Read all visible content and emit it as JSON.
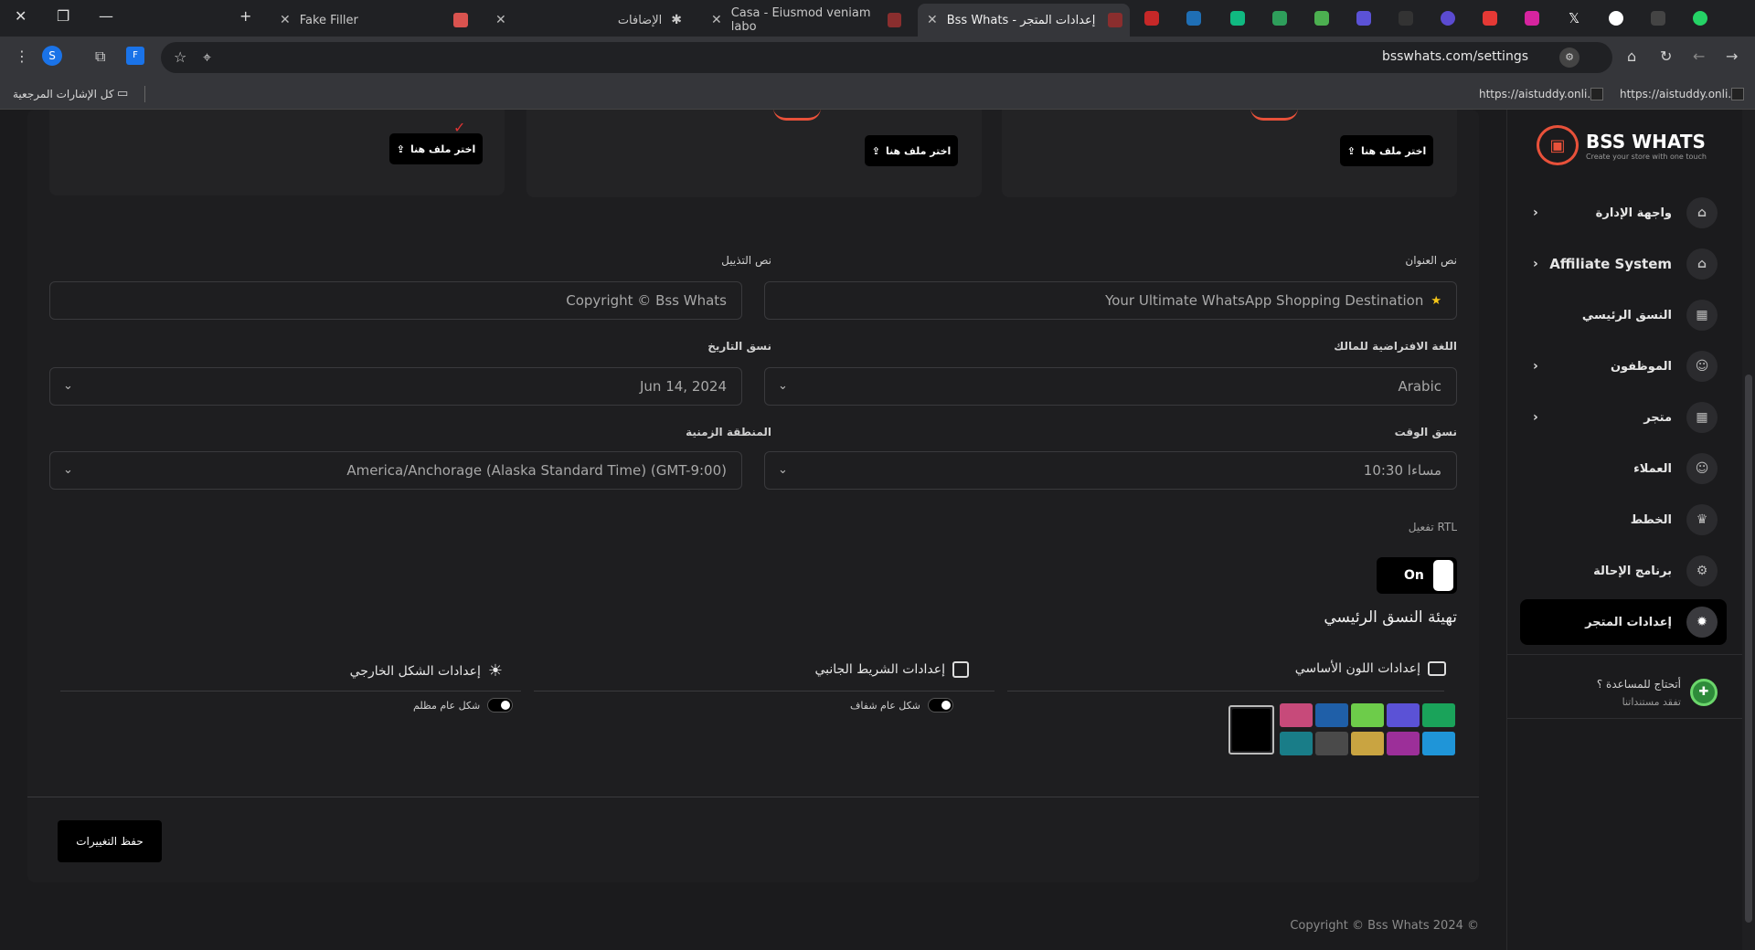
{
  "browser": {
    "tabs": [
      {
        "title": "Fake Filler"
      },
      {
        "title": "الإضافات"
      },
      {
        "title": "Casa - Eiusmod veniam labo"
      },
      {
        "title": "Bss Whats - إعدادات المتجر"
      }
    ],
    "url": "bsswhats.com/settings",
    "bookmarks": {
      "all_bookmarks": "كل الإشارات المرجعية",
      "bm1": "https://aistuddy.onli...",
      "bm2": "https://aistuddy.onli..."
    },
    "profile_initial": "S"
  },
  "logo": {
    "title": "BSS WHATS",
    "tagline": "Create your store with one touch"
  },
  "sidebar": {
    "items": [
      {
        "label": "واجهة الإدارة"
      },
      {
        "label": "Affiliate System"
      },
      {
        "label": "النسق الرئيسي"
      },
      {
        "label": "الموظفون"
      },
      {
        "label": "متجر"
      },
      {
        "label": "العملاء"
      },
      {
        "label": "الخطط"
      },
      {
        "label": "برنامج الإحالة"
      },
      {
        "label": "إعدادات المتجر"
      }
    ],
    "help": {
      "title": "أتحتاج للمساعدة ؟",
      "subtitle": "تفقد مستنداتنا"
    }
  },
  "uploads": {
    "button_label": "اختر ملف هنا"
  },
  "form": {
    "header_text_label": "نص العنوان",
    "header_text_value": "Your Ultimate WhatsApp Shopping Destination",
    "footer_text_label": "نص التذييل",
    "footer_text_value": "Copyright © Bss Whats",
    "default_language_label": "اللغة الافتراضية للمالك",
    "default_language_value": "Arabic",
    "date_format_label": "نسق التاريخ",
    "date_format_value": "Jun 14, 2024",
    "time_format_label": "نسق الوقت",
    "time_format_value": "10:30 مساءا",
    "timezone_label": "المنطقة الزمنية",
    "timezone_value": "America/Anchorage (Alaska Standard Time) (GMT-9:00)",
    "rtl_label": "تفعيل RTL",
    "rtl_state": "On"
  },
  "theme": {
    "title": "تهيئة النسق الرئيسي",
    "primary_color_title": "إعدادات اللون الأساسي",
    "sidebar_title": "إعدادات الشريط الجانبي",
    "sidebar_toggle_label": "شكل عام شفاف",
    "layout_title": "إعدادات الشكل الخارجي",
    "layout_toggle_label": "شكل عام مظلم",
    "colors": [
      "#1aa35a",
      "#5b52d6",
      "#6dcc4a",
      "#1f5fa8",
      "#c74a7a",
      "#1f95d8",
      "#9c2f99",
      "#c9a441",
      "#4a4a4a",
      "#197d88"
    ],
    "selected_color": "#000000"
  },
  "save_button": "حفظ التغييرات",
  "footer": {
    "copyright": "Copyright © Bss Whats 2024 ©"
  }
}
